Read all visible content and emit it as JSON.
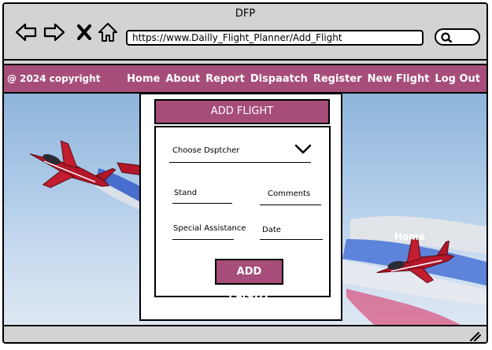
{
  "window": {
    "title": "DFP"
  },
  "browser": {
    "url": "https://www.Dailly_Flight_Planner/Add_Flight"
  },
  "navbar": {
    "copyright": "@ 2024 copyright",
    "links": [
      "Home",
      "About",
      "Report",
      "Dispaatch",
      "Register",
      "New Flight",
      "Log Out"
    ],
    "background": "#a64d79"
  },
  "hero": {
    "overlay_label": "Home"
  },
  "form": {
    "title": "ADD FLIGHT",
    "dispatcher_placeholder": "Choose Dsptcher",
    "stand_label": "Stand",
    "comments_label": "Comments",
    "special_assistance_label": "Special Assistance",
    "date_label": "Date",
    "submit_label": "ADD FLIGHT"
  },
  "icons": [
    "back-arrow-icon",
    "forward-arrow-icon",
    "close-icon",
    "home-icon",
    "search-icon",
    "chevron-down-icon",
    "resize-grip-icon"
  ]
}
